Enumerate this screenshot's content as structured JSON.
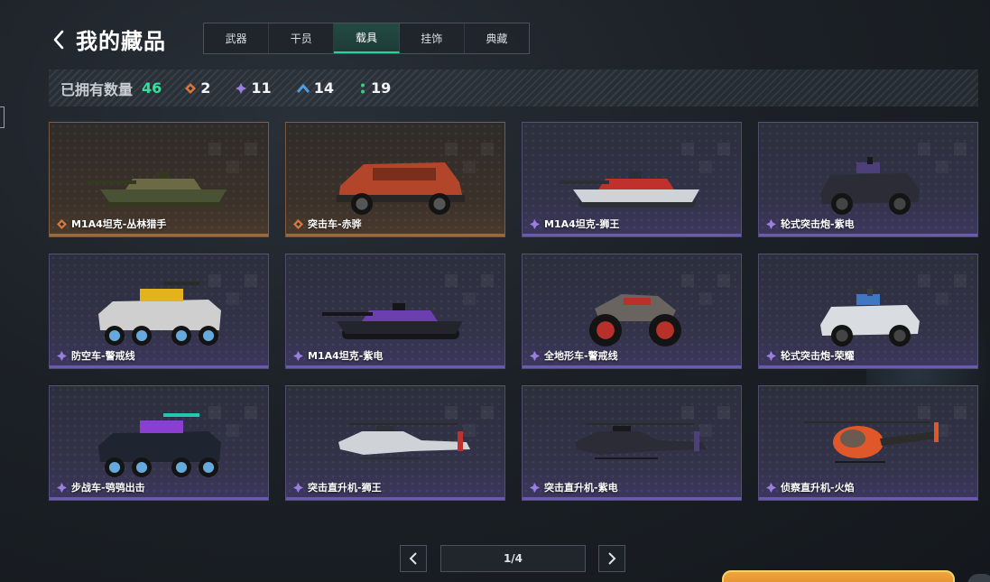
{
  "header": {
    "title": "我的藏品",
    "back_icon": "chevron-left-icon"
  },
  "tabs": [
    {
      "label": "武器",
      "active": false
    },
    {
      "label": "干员",
      "active": false
    },
    {
      "label": "载具",
      "active": true
    },
    {
      "label": "挂饰",
      "active": false
    },
    {
      "label": "典藏",
      "active": false
    }
  ],
  "summary": {
    "label": "已拥有数量",
    "total": "46",
    "rarities": [
      {
        "icon": "gold-diamond-icon",
        "color": "#d9773a",
        "count": "2"
      },
      {
        "icon": "purple-diamond-icon",
        "color": "#9b7fe0",
        "count": "11"
      },
      {
        "icon": "blue-chevron-icon",
        "color": "#4f9de0",
        "count": "14"
      },
      {
        "icon": "green-dots-icon",
        "color": "#35d07f",
        "count": "19"
      }
    ]
  },
  "items": [
    {
      "name": "M1A4坦克-丛林猎手",
      "rarity": "gold",
      "kind": "tank",
      "skin": "camo"
    },
    {
      "name": "突击车-赤骅",
      "rarity": "gold",
      "kind": "assault_car",
      "skin": "red"
    },
    {
      "name": "M1A4坦克-狮王",
      "rarity": "purple",
      "kind": "tank",
      "skin": "white_red"
    },
    {
      "name": "轮式突击炮-紫电",
      "rarity": "purple",
      "kind": "armored_car",
      "skin": "dark"
    },
    {
      "name": "防空车-警戒线",
      "rarity": "purple",
      "kind": "ifv",
      "skin": "hazard"
    },
    {
      "name": "M1A4坦克-紫电",
      "rarity": "purple",
      "kind": "tank",
      "skin": "dark_purple"
    },
    {
      "name": "全地形车-警戒线",
      "rarity": "purple",
      "kind": "atv",
      "skin": "hazard_red"
    },
    {
      "name": "轮式突击炮-荣耀",
      "rarity": "purple",
      "kind": "armored_car",
      "skin": "white_blue"
    },
    {
      "name": "步战车-鸮鸮出击",
      "rarity": "purple",
      "kind": "ifv",
      "skin": "graffiti"
    },
    {
      "name": "突击直升机-狮王",
      "rarity": "purple",
      "kind": "helicopter",
      "skin": "white_red"
    },
    {
      "name": "突击直升机-紫电",
      "rarity": "purple",
      "kind": "helicopter",
      "skin": "dark"
    },
    {
      "name": "侦察直升机-火焰",
      "rarity": "purple",
      "kind": "light_heli",
      "skin": "flame"
    }
  ],
  "pagination": {
    "current": "1/4",
    "prev_icon": "chevron-left-icon",
    "next_icon": "chevron-right-icon"
  }
}
